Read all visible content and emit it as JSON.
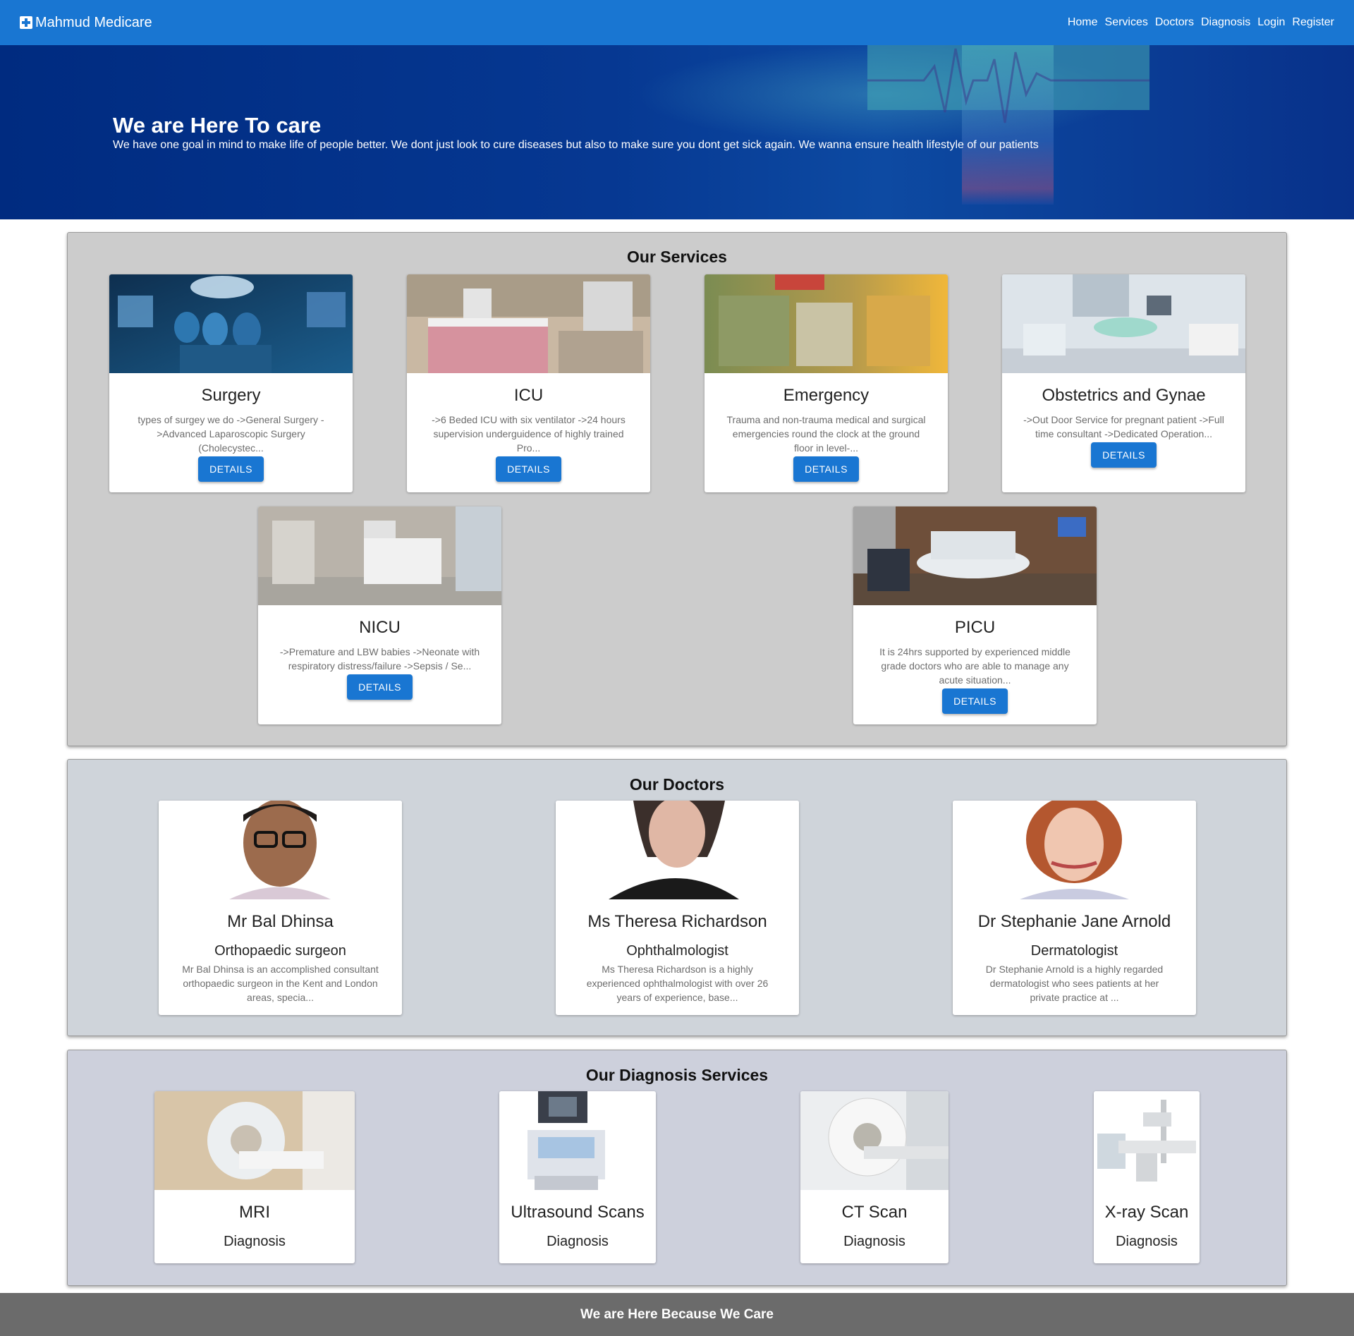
{
  "nav": {
    "brand": "Mahmud Medicare",
    "links": [
      "Home",
      "Services",
      "Doctors",
      "Diagnosis",
      "Login",
      "Register"
    ]
  },
  "hero": {
    "title": "We are Here To care",
    "subtitle": "We have one goal in mind to make life of people better. We dont just look to cure diseases but also to make sure you dont get sick again. We wanna ensure health lifestyle of our patients"
  },
  "services": {
    "title": "Our Services",
    "button_label": "DETAILS",
    "items": [
      {
        "name": "Surgery",
        "desc": "types of surgey we do ->General Surgery ->Advanced Laparoscopic Surgery (Cholecystec..."
      },
      {
        "name": "ICU",
        "desc": "->6 Beded ICU with six ventilator ->24 hours supervision underguidence of highly trained Pro..."
      },
      {
        "name": "Emergency",
        "desc": "Trauma and non-trauma medical and surgical emergencies round the clock at the ground floor in level-..."
      },
      {
        "name": "Obstetrics and Gynae",
        "desc": "->Out Door Service for pregnant patient ->Full time consultant ->Dedicated Operation..."
      },
      {
        "name": "NICU",
        "desc": "->Premature and LBW babies ->Neonate with respiratory distress/failure ->Sepsis / Se..."
      },
      {
        "name": "PICU",
        "desc": "It is 24hrs supported by experienced middle grade doctors who are able to manage any acute situation..."
      }
    ]
  },
  "doctors": {
    "title": "Our Doctors",
    "items": [
      {
        "name": "Mr Bal Dhinsa",
        "role": "Orthopaedic surgeon",
        "desc": "Mr Bal Dhinsa is an accomplished consultant orthopaedic surgeon in the Kent and London areas, specia..."
      },
      {
        "name": "Ms Theresa Richardson",
        "role": "Ophthalmologist",
        "desc": "Ms Theresa Richardson is a highly experienced ophthalmologist with over 26 years of experience, base..."
      },
      {
        "name": "Dr Stephanie Jane Arnold",
        "role": "Dermatologist",
        "desc": "Dr Stephanie Arnold is a highly regarded dermatologist who sees patients at her private practice at ..."
      }
    ]
  },
  "diagnosis": {
    "title": "Our Diagnosis Services",
    "items": [
      {
        "name": "MRI",
        "sub": "Diagnosis"
      },
      {
        "name": "Ultrasound Scans",
        "sub": "Diagnosis"
      },
      {
        "name": "CT Scan",
        "sub": "Diagnosis"
      },
      {
        "name": "X-ray Scan",
        "sub": "Diagnosis"
      }
    ]
  },
  "footer": {
    "text": "We are Here Because We Care"
  },
  "colors": {
    "primary": "#1976d2",
    "hero": "#06308a",
    "footer": "#6b6b6b"
  }
}
